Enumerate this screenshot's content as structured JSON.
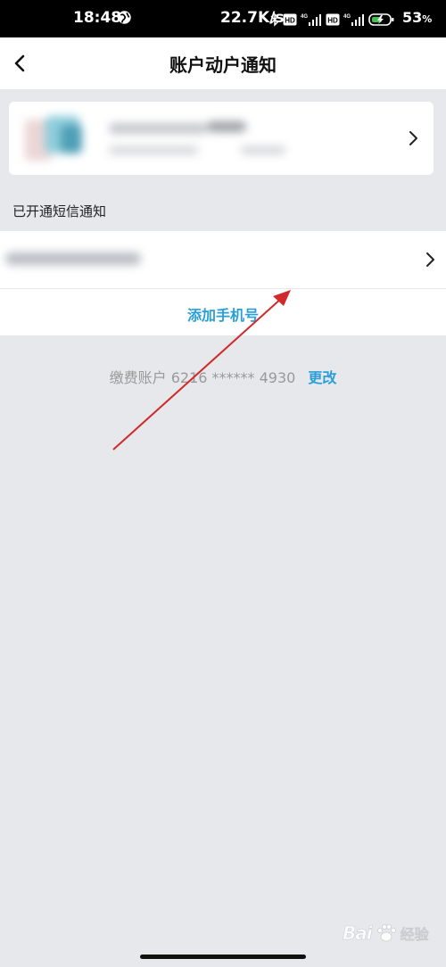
{
  "status_bar": {
    "time": "18:48",
    "network_speed": "22.7K/s",
    "battery_percent": "53",
    "battery_symbol": "%"
  },
  "header": {
    "title": "账户动户通知"
  },
  "section": {
    "label": "已开通短信通知"
  },
  "add_phone": {
    "label": "添加手机号"
  },
  "payment": {
    "text": "缴费账户 6216 ****** 4930",
    "change_label": "更改"
  },
  "watermark": {
    "brand": "Bai",
    "brand_suffix": "经验"
  },
  "colors": {
    "accent": "#2a9fd6",
    "background": "#e6e8ec",
    "annotation_arrow": "#d02a2a"
  },
  "icons": [
    "back-arrow-icon",
    "globe-icon",
    "bluetooth-icon",
    "hd-icon",
    "signal-icon",
    "battery-icon",
    "chevron-right-icon",
    "paw-icon"
  ]
}
